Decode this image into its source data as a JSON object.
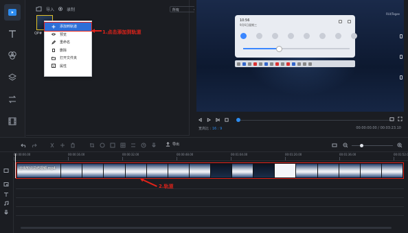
{
  "sidebar": {
    "tools": [
      {
        "name": "media-tool"
      },
      {
        "name": "text-tool"
      },
      {
        "name": "filter-tool"
      },
      {
        "name": "overlay-tool"
      },
      {
        "name": "transition-tool"
      },
      {
        "name": "element-tool"
      }
    ]
  },
  "media": {
    "import_label": "导入",
    "record_label": "录制",
    "filter_value": "所有",
    "thumb_label": "QP#"
  },
  "context_menu": {
    "items": [
      {
        "label": "添加到轨道",
        "icon": "plus-icon"
      },
      {
        "label": "预览",
        "icon": "eye-icon"
      },
      {
        "label": "重命名",
        "icon": "edit-icon"
      },
      {
        "label": "删除",
        "icon": "trash-icon"
      },
      {
        "label": "打开文件夹",
        "icon": "folder-icon"
      },
      {
        "label": "属性",
        "icon": "info-icon"
      }
    ]
  },
  "annotations": {
    "step1": "1.点击添加到轨道",
    "step2": "2.轨道"
  },
  "preview": {
    "watermark": "RUI/Tegee",
    "qs_time": "10:56",
    "qs_date": "9月6日星期三",
    "aspect_label": "宽高比 :",
    "aspect_value": "16 : 9",
    "timecode": "00:00:00.00 / 00:03:23.10"
  },
  "timeline": {
    "export_label": "导出",
    "ruler": [
      "00:00:00.00",
      "00:00:16.00",
      "00:00:32.00",
      "00:00:48.00",
      "00:01:04.00",
      "00:01:20.00",
      "00:01:36.00",
      "00:01:52.00"
    ],
    "clip_title": "云库知识总结视频.mp4",
    "clip_count": 17
  },
  "colors": {
    "accent": "#2d8cf0",
    "annotation": "#e2231a",
    "highlight": "#2d6fd8",
    "thumb_border": "#e3c32a"
  }
}
